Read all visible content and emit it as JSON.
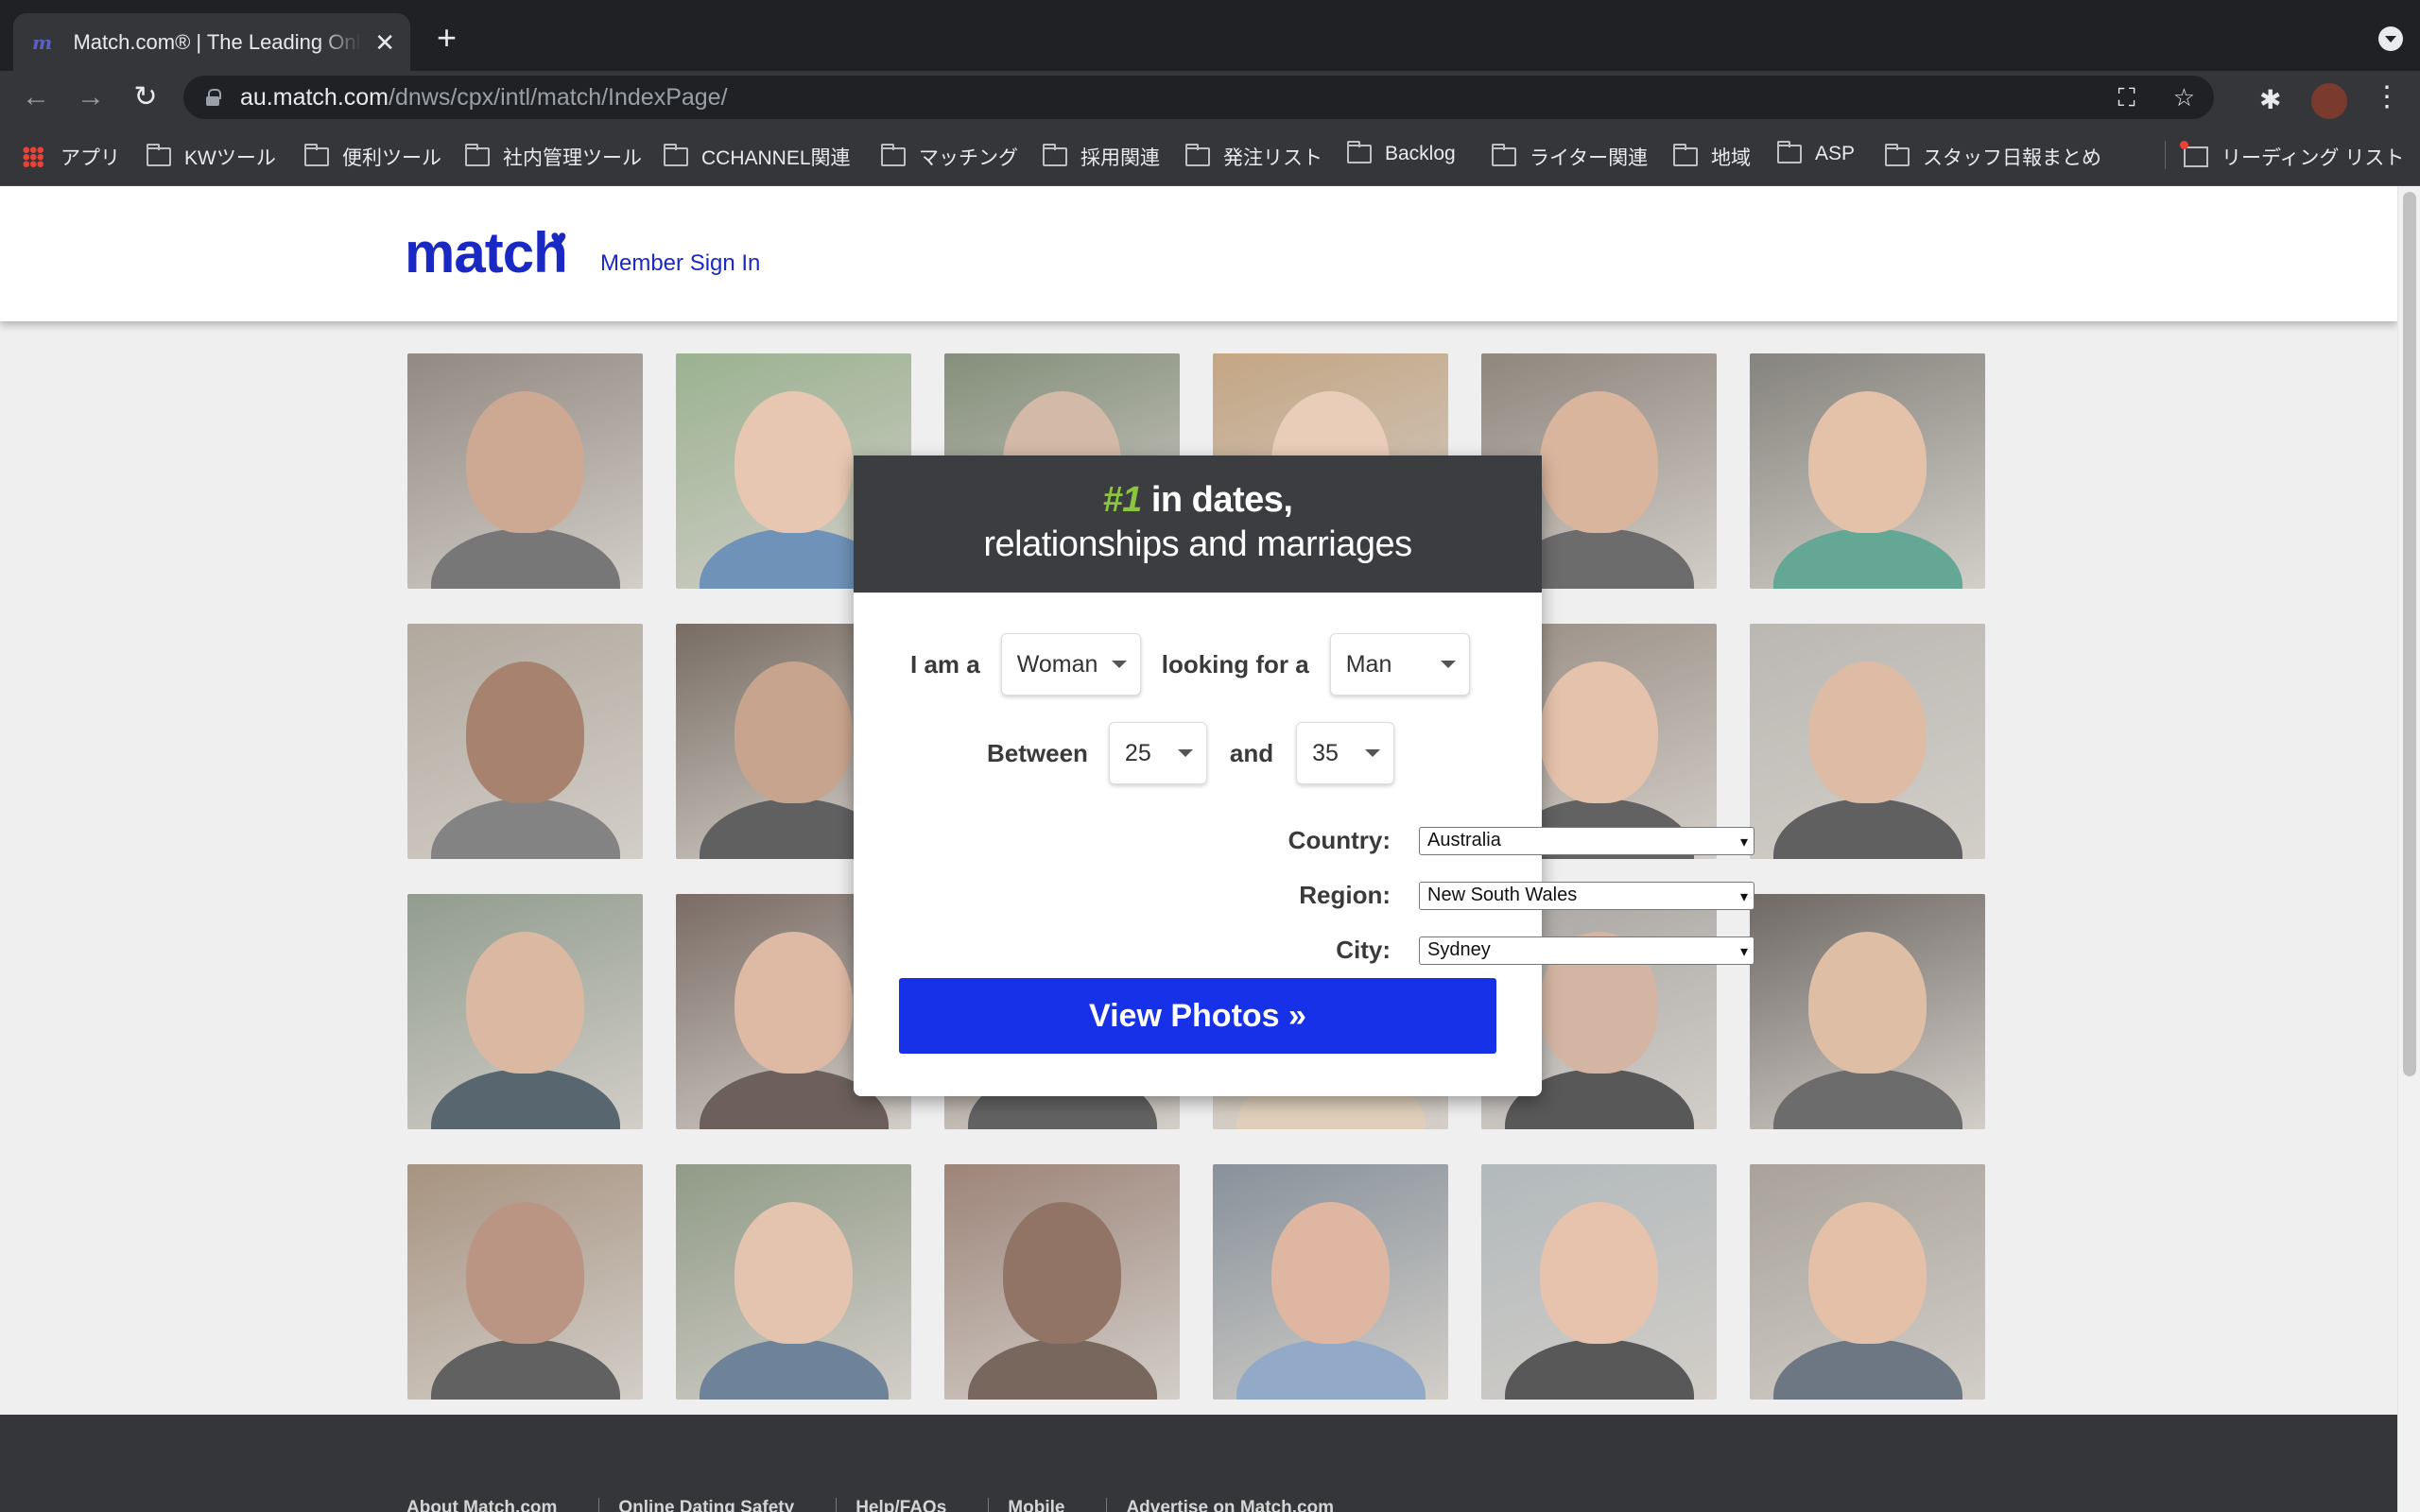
{
  "browser": {
    "tab_title": "Match.com® | The Leading Online Dating Site",
    "tab_favicon": "m",
    "url_host": "au.match.com",
    "url_path": "/dnws/cpx/intl/match/IndexPage/",
    "bookmarks": [
      {
        "label": "アプリ",
        "icon": "apps-grid-icon"
      },
      {
        "label": "KWツール",
        "icon": "folder-icon"
      },
      {
        "label": "便利ツール",
        "icon": "folder-icon"
      },
      {
        "label": "社内管理ツール",
        "icon": "folder-icon"
      },
      {
        "label": "CCHANNEL関連",
        "icon": "folder-icon"
      },
      {
        "label": "マッチング",
        "icon": "folder-icon"
      },
      {
        "label": "採用関連",
        "icon": "folder-icon"
      },
      {
        "label": "発注リスト",
        "icon": "folder-icon"
      },
      {
        "label": "Backlog",
        "icon": "folder-icon"
      },
      {
        "label": "ライター関連",
        "icon": "folder-icon"
      },
      {
        "label": "地域",
        "icon": "folder-icon"
      },
      {
        "label": "ASP",
        "icon": "folder-icon"
      },
      {
        "label": "スタッフ日報まとめ",
        "icon": "folder-icon"
      }
    ],
    "reading_list": "リーディング リスト"
  },
  "header": {
    "logo": "match",
    "signin": "Member Sign In"
  },
  "modal": {
    "headline_num": "#1",
    "headline_rest": " in dates,",
    "headline_line2": "relationships and marriages",
    "i_am_label": "I am a",
    "i_am_value": "Woman",
    "looking_label": "looking for a",
    "looking_value": "Man",
    "between_label": "Between",
    "age_min": "25",
    "and_label": "and",
    "age_max": "35",
    "country_label": "Country:",
    "country_value": "Australia",
    "region_label": "Region:",
    "region_value": "New South Wales",
    "city_label": "City:",
    "city_value": "Sydney",
    "button": "View Photos »"
  },
  "footer": {
    "links": [
      "About Match.com",
      "Online Dating Safety",
      "Help/FAQs",
      "Mobile",
      "Advertise on Match.com"
    ]
  },
  "colors": {
    "brand": "#1a29c4",
    "button": "#1631e8",
    "accent_green": "#8cc63f",
    "modal_header": "#3c3d41"
  },
  "photos": [
    {
      "bg": "#6f6258",
      "skin": "#c08f72",
      "shirt": "#4a4a4a"
    },
    {
      "bg": "#7a9b6c",
      "skin": "#e4b89a",
      "shirt": "#3f6fa3"
    },
    {
      "bg": "#5b6a4e",
      "skin": "#c9a58c",
      "shirt": "#666"
    },
    {
      "bg": "#b48a5b",
      "skin": "#e8c1a5",
      "shirt": "#d8c0a0"
    },
    {
      "bg": "#6b5e52",
      "skin": "#d29f80",
      "shirt": "#3b3b3b"
    },
    {
      "bg": "#5d5a52",
      "skin": "#e0b08f",
      "shirt": "#2f8c72"
    },
    {
      "bg": "#9a8e7e",
      "skin": "#8c5a3f",
      "shirt": "#5a5a5a"
    },
    {
      "bg": "#4b3b2e",
      "skin": "#b98868",
      "shirt": "#2a2a2a"
    },
    {
      "bg": "#c6b8a6",
      "skin": "#c79479",
      "shirt": "#d2c2b0"
    },
    {
      "bg": "#c9b093",
      "skin": "#e3b7a0",
      "shirt": "#b9a48a"
    },
    {
      "bg": "#7a6b5e",
      "skin": "#e2b193",
      "shirt": "#2c2c2c"
    },
    {
      "bg": "#a7a39c",
      "skin": "#d8a889",
      "shirt": "#2a2a2a"
    },
    {
      "bg": "#6e7d6a",
      "skin": "#d4a385",
      "shirt": "#1f3240"
    },
    {
      "bg": "#4e3a30",
      "skin": "#d8a588",
      "shirt": "#3c2a24"
    },
    {
      "bg": "#6a5848",
      "skin": "#b88266",
      "shirt": "#2d2d2d"
    },
    {
      "bg": "#cdb89c",
      "skin": "#e6c2a7",
      "shirt": "#d9c4a6"
    },
    {
      "bg": "#8e8a86",
      "skin": "#caa086",
      "shirt": "#1f1f1f"
    },
    {
      "bg": "#3e3630",
      "skin": "#d9ac8a",
      "shirt": "#3a3a3a"
    },
    {
      "bg": "#8b6f55",
      "skin": "#a7735a",
      "shirt": "#2b2b2b"
    },
    {
      "bg": "#6b7a5e",
      "skin": "#e0b497",
      "shirt": "#3d5a78"
    },
    {
      "bg": "#7d5a4a",
      "skin": "#6e4632",
      "shirt": "#4a3426"
    },
    {
      "bg": "#5f6d7a",
      "skin": "#d8a184",
      "shirt": "#6f8fb8"
    },
    {
      "bg": "#9aa4a8",
      "skin": "#e4b394",
      "shirt": "#1f1f1f"
    },
    {
      "bg": "#8c8478",
      "skin": "#e1ae8f",
      "shirt": "#3a4a5a"
    }
  ]
}
